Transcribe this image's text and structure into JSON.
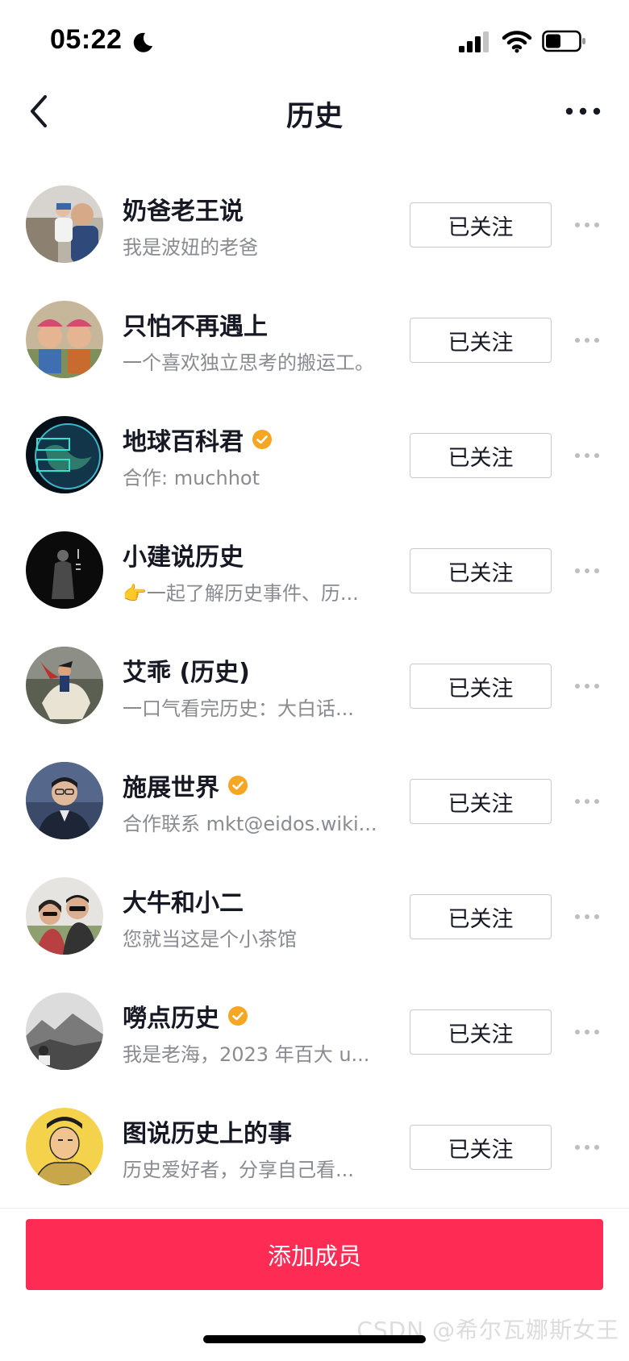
{
  "status_bar": {
    "time": "05:22"
  },
  "nav": {
    "title": "历史"
  },
  "accounts": [
    {
      "name": "奶爸老王说",
      "bio": "我是波妞的老爸",
      "verified": false,
      "button": "已关注",
      "avatar": "family-photo"
    },
    {
      "name": "只怕不再遇上",
      "bio": "一个喜欢独立思考的搬运工。",
      "verified": false,
      "button": "已关注",
      "avatar": "kids-photo"
    },
    {
      "name": "地球百科君",
      "bio": "合作: muchhot",
      "verified": true,
      "button": "已关注",
      "avatar": "globe-logo"
    },
    {
      "name": "小建说历史",
      "bio": "👉一起了解历史事件、历...",
      "verified": false,
      "button": "已关注",
      "avatar": "dark-figure"
    },
    {
      "name": "艾乖 (历史)",
      "bio": "一口气看完历史：大白话...",
      "verified": false,
      "button": "已关注",
      "avatar": "napoleon-painting"
    },
    {
      "name": "施展世界",
      "bio": "合作联系 mkt@eidos.wiki...",
      "verified": true,
      "button": "已关注",
      "avatar": "man-glasses"
    },
    {
      "name": "大牛和小二",
      "bio": "您就当这是个小茶馆",
      "verified": false,
      "button": "已关注",
      "avatar": "couple-selfie"
    },
    {
      "name": "嘮点历史",
      "bio": "我是老海，2023 年百大 u...",
      "verified": true,
      "button": "已关注",
      "avatar": "mountain-bw"
    },
    {
      "name": "图说历史上的事",
      "bio": "历史爱好者，分享自己看...",
      "verified": false,
      "button": "已关注",
      "avatar": "scholar-drawing"
    }
  ],
  "footer": {
    "add_member_label": "添加成员"
  },
  "watermark": "CSDN @希尔瓦娜斯女王",
  "colors": {
    "accent": "#fe2c55",
    "verified": "#f5a623",
    "secondary_text": "#8a8b91"
  }
}
